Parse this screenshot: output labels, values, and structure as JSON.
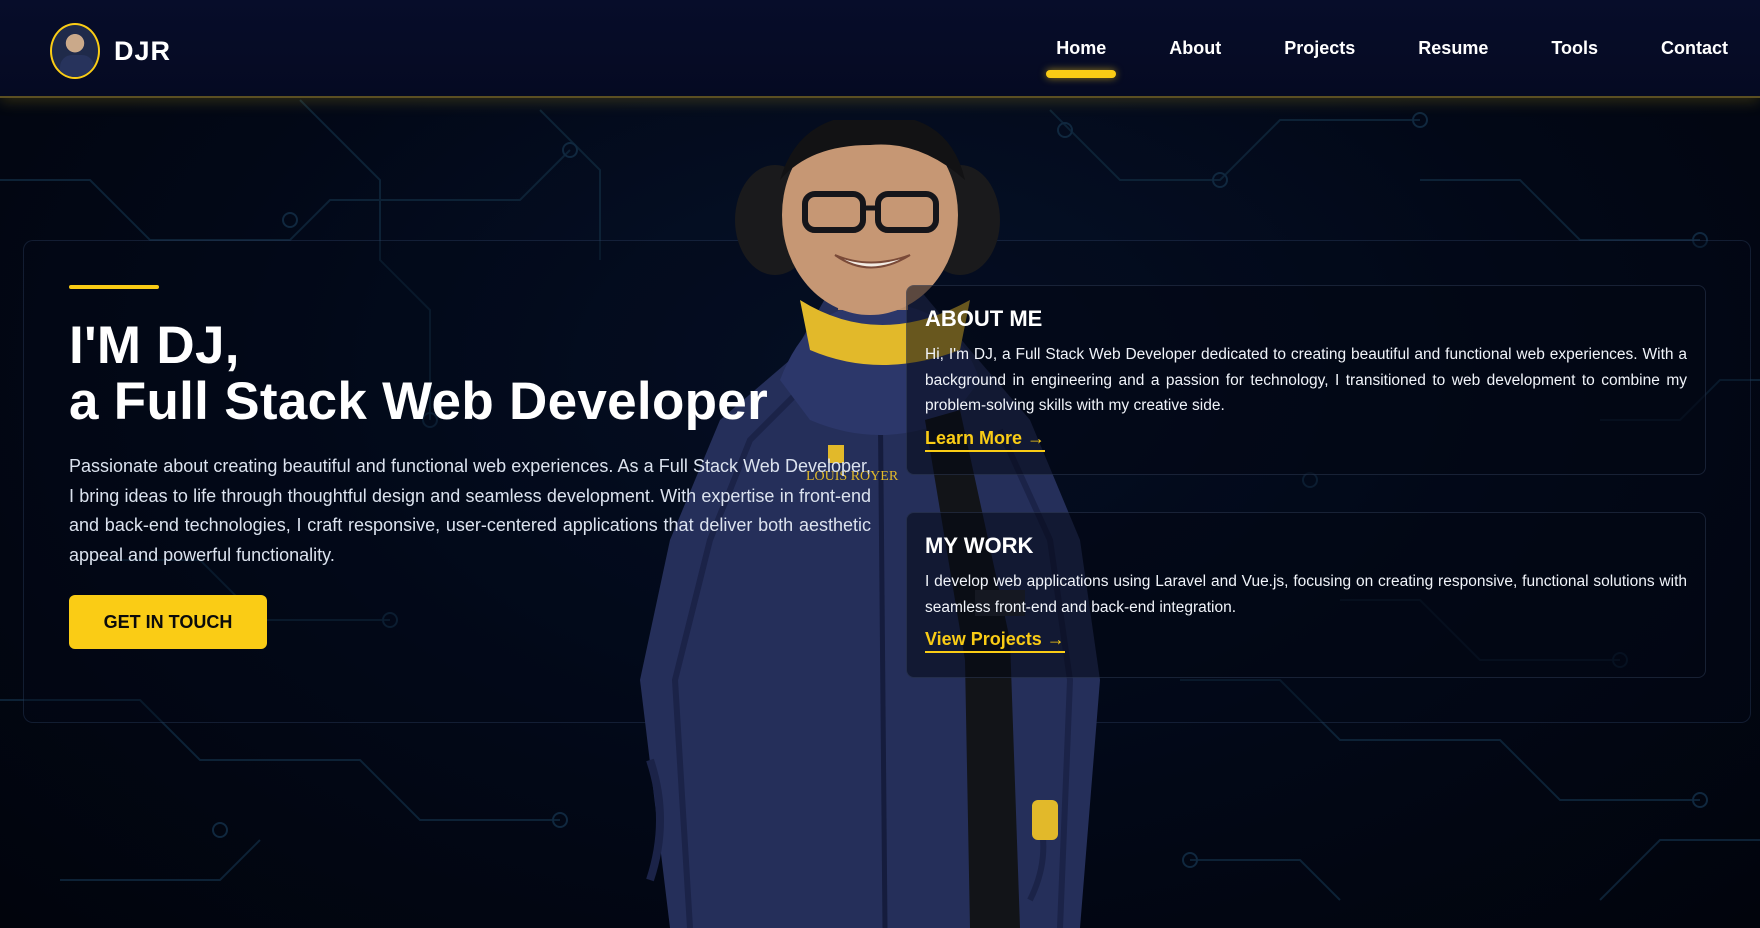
{
  "header": {
    "brand": "DJR",
    "nav": [
      {
        "label": "Home",
        "active": true
      },
      {
        "label": "About",
        "active": false
      },
      {
        "label": "Projects",
        "active": false
      },
      {
        "label": "Resume",
        "active": false
      },
      {
        "label": "Tools",
        "active": false
      },
      {
        "label": "Contact",
        "active": false
      }
    ]
  },
  "hero": {
    "title_line1": "I'M DJ,",
    "title_line2": "a Full Stack Web Developer",
    "intro": "Passionate about creating beautiful and functional web experiences. As a Full Stack Web Developer, I bring ideas to life through thoughtful design and seamless development. With expertise in front-end and back-end technologies, I craft responsive, user-centered applications that deliver both aesthetic appeal and powerful functionality.",
    "cta": "GET IN TOUCH"
  },
  "about_card": {
    "title": "ABOUT ME",
    "text": "Hi, I'm DJ, a Full Stack Web Developer dedicated to creating beautiful and functional web experiences. With a background in engineering and a passion for technology, I transitioned to web development to combine my problem-solving skills with my creative side.",
    "link": "Learn More →"
  },
  "work_card": {
    "title": "MY WORK",
    "text": "I develop web applications using Laravel and Vue.js, focusing on creating responsive, functional solutions with seamless front-end and back-end integration.",
    "link": "View Projects →"
  },
  "jacket_logo": "LOUIS ROYER",
  "colors": {
    "accent": "#facc15",
    "background": "#020817",
    "header": "#070d2a",
    "jacket": "#252f5a"
  },
  "icons": [
    "avatar-photo",
    "circuit-pattern"
  ]
}
